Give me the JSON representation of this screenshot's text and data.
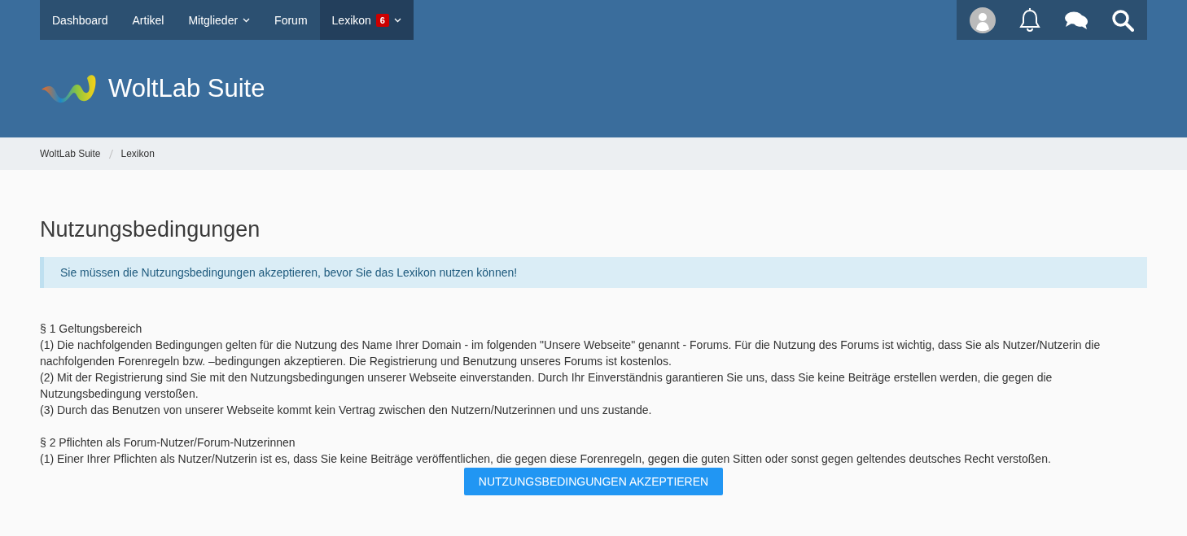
{
  "nav": {
    "items": [
      {
        "label": "Dashboard",
        "selected": false,
        "dropdown": false
      },
      {
        "label": "Artikel",
        "selected": false,
        "dropdown": false
      },
      {
        "label": "Mitglieder",
        "selected": false,
        "dropdown": true
      },
      {
        "label": "Forum",
        "selected": false,
        "dropdown": false
      },
      {
        "label": "Lexikon",
        "selected": true,
        "dropdown": true,
        "badge": "6"
      }
    ]
  },
  "logo": {
    "text": "WoltLab Suite"
  },
  "breadcrumbs": [
    "WoltLab Suite",
    "Lexikon"
  ],
  "page_title": "Nutzungsbedingungen",
  "info": "Sie müssen die Nutzungsbedingungen akzeptieren, bevor Sie das Lexikon nutzen können!",
  "sections": [
    {
      "heading": "§ 1 Geltungsbereich",
      "paragraphs": [
        "(1) Die nachfolgenden Bedingungen gelten für die Nutzung des Name Ihrer Domain - im folgenden \"Unsere Webseite\" genannt - Forums. Für die Nutzung des Forums ist wichtig, dass Sie als Nutzer/Nutzerin die nachfolgenden Forenregeln bzw. –bedingungen akzeptieren. Die Registrierung und Benutzung unseres Forums ist kostenlos.",
        "(2) Mit der Registrierung sind Sie mit den Nutzungsbedingungen unserer Webseite einverstanden. Durch Ihr Einverständnis garantieren Sie uns, dass Sie keine Beiträge erstellen werden, die gegen die Nutzungsbedingung verstoßen.",
        "(3) Durch das Benutzen von unserer Webseite kommt kein Vertrag zwischen den Nutzern/Nutzerinnen und uns zustande."
      ]
    },
    {
      "heading": "§ 2 Pflichten als Forum-Nutzer/Forum-Nutzerinnen",
      "paragraphs": [
        "(1) Einer Ihrer Pflichten als Nutzer/Nutzerin ist es, dass Sie keine Beiträge veröffentlichen, die gegen diese Forenregeln, gegen die guten Sitten oder sonst gegen geltendes deutsches Recht verstoßen."
      ]
    }
  ],
  "accept_button": "NUTZUNGSBEDINGUNGEN AKZEPTIEREN"
}
